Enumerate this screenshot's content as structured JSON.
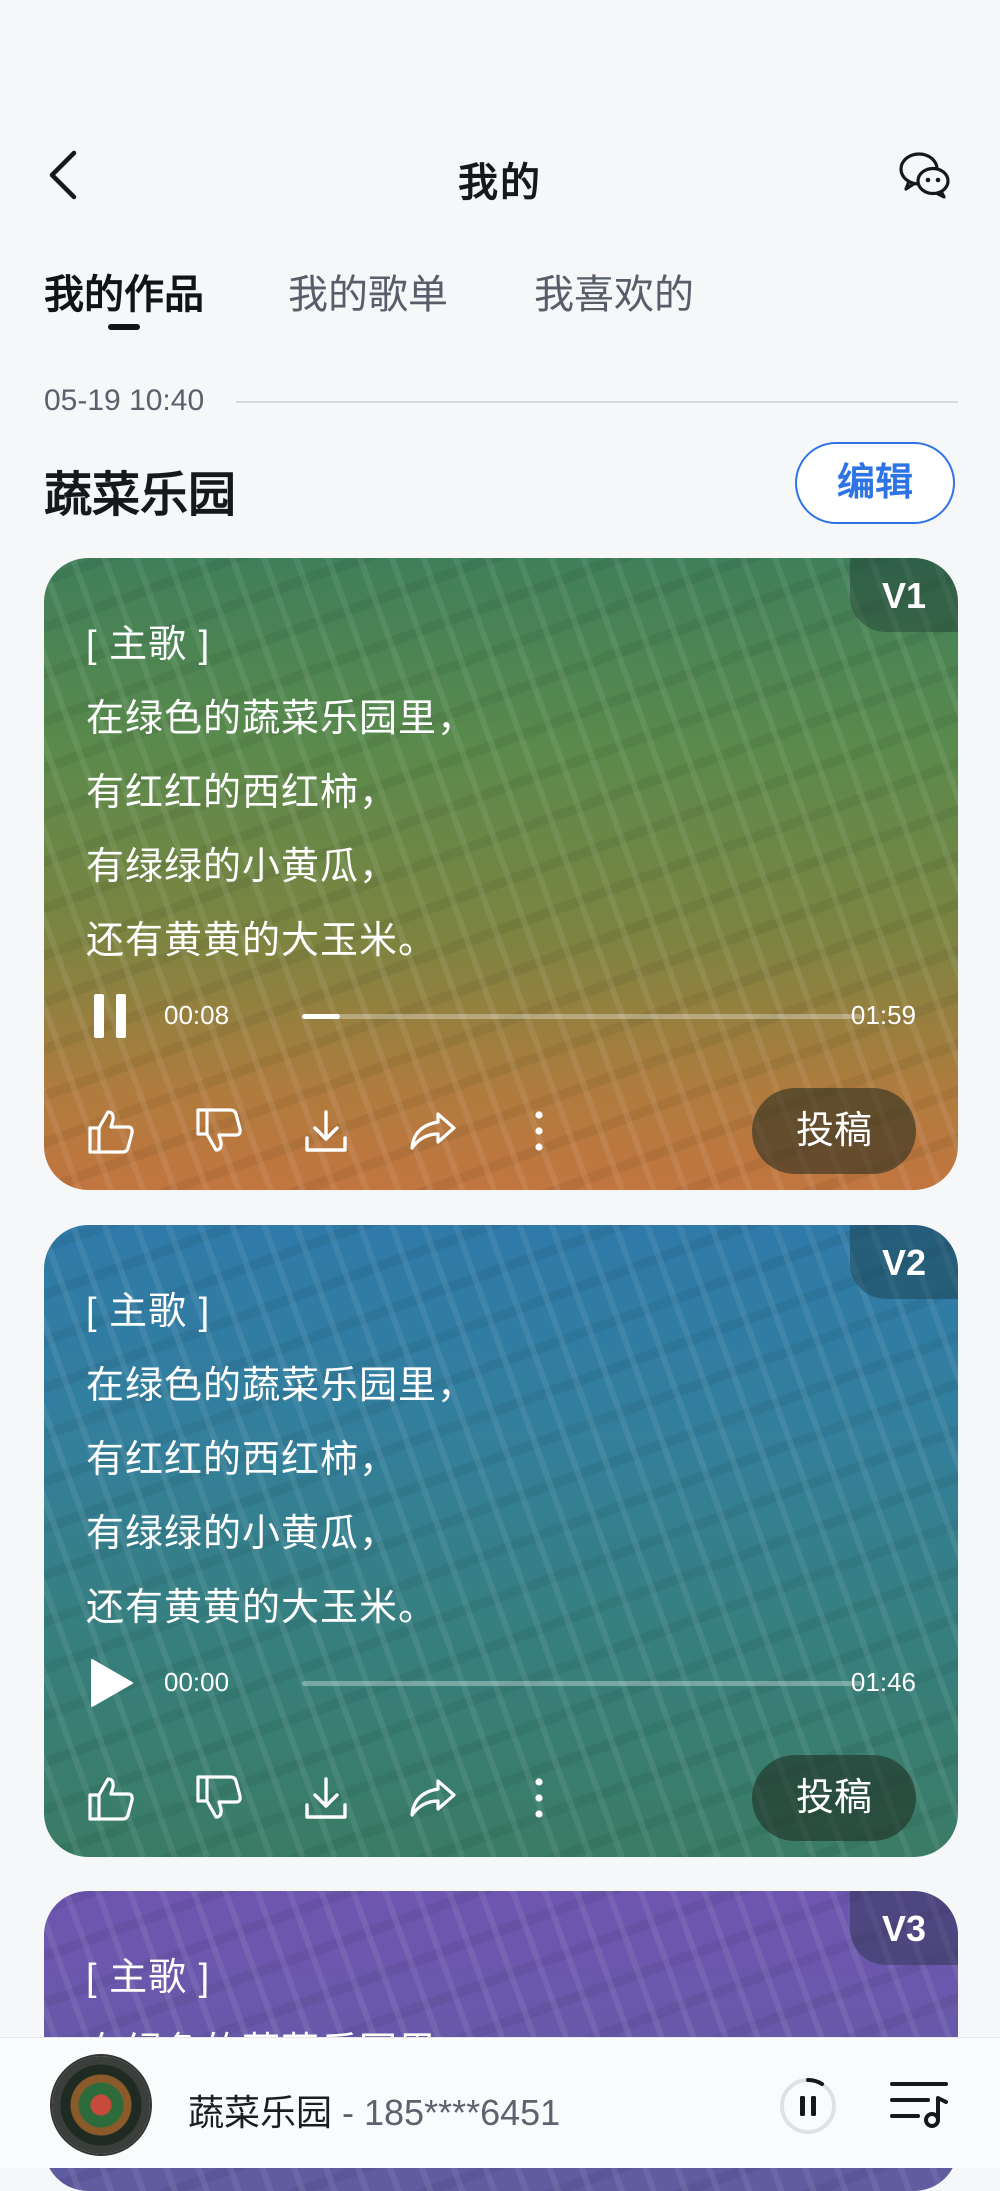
{
  "header": {
    "title": "我的"
  },
  "tabs": [
    {
      "label": "我的作品",
      "active": true
    },
    {
      "label": "我的歌单",
      "active": false
    },
    {
      "label": "我喜欢的",
      "active": false
    }
  ],
  "work": {
    "date": "05-19 10:40",
    "title": "蔬菜乐园",
    "edit_label": "编辑"
  },
  "cards": [
    {
      "version": "V1",
      "lyrics": [
        "[ 主歌 ]",
        "在绿色的蔬菜乐园里，",
        "有红红的西红柿，",
        "有绿绿的小黄瓜，",
        "还有黄黄的大玉米。"
      ],
      "current_time": "00:08",
      "total_time": "01:59",
      "progress": 0.067,
      "playing": true,
      "submit_label": "投稿"
    },
    {
      "version": "V2",
      "lyrics": [
        "[ 主歌 ]",
        "在绿色的蔬菜乐园里，",
        "有红红的西红柿，",
        "有绿绿的小黄瓜，",
        "还有黄黄的大玉米。"
      ],
      "current_time": "00:00",
      "total_time": "01:46",
      "progress": 0,
      "playing": false,
      "submit_label": "投稿"
    },
    {
      "version": "V3",
      "lyrics": [
        "[ 主歌 ]",
        "在绿色的蔬菜乐园里，"
      ]
    }
  ],
  "mini_player": {
    "title": "蔬菜乐园",
    "separator": " - ",
    "artist": "185****6451"
  },
  "icons": {
    "back": "chevron-left-icon",
    "chat": "wechat-icon",
    "pause": "pause-icon",
    "play": "play-icon",
    "like": "thumbs-up-icon",
    "dislike": "thumbs-down-icon",
    "download": "download-icon",
    "share": "share-icon",
    "more": "more-vertical-icon",
    "playlist": "playlist-icon"
  },
  "colors": {
    "accent": "#2f74e4"
  }
}
